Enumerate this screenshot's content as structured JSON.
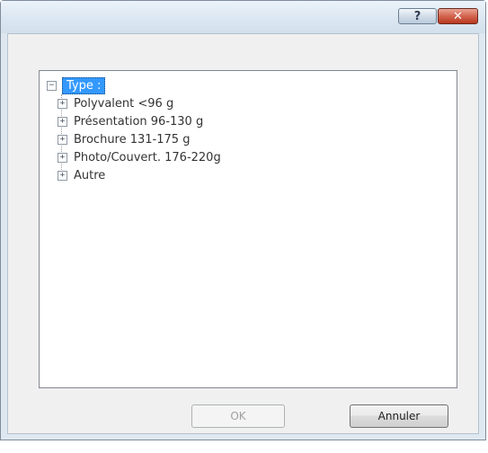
{
  "titlebar": {
    "help_label": "?",
    "close_label": "✕"
  },
  "tree": {
    "root": {
      "label": "Type :",
      "expander": "−"
    },
    "children": [
      {
        "label": "Polyvalent <96 g",
        "expander": "+"
      },
      {
        "label": "Présentation 96-130 g",
        "expander": "+"
      },
      {
        "label": "Brochure 131-175 g",
        "expander": "+"
      },
      {
        "label": "Photo/Couvert. 176-220g",
        "expander": "+"
      },
      {
        "label": "Autre",
        "expander": "+"
      }
    ]
  },
  "buttons": {
    "ok_label": "OK",
    "cancel_label": "Annuler"
  }
}
